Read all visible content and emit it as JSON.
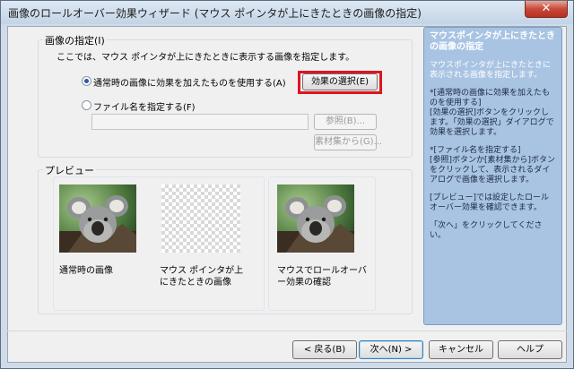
{
  "window": {
    "title": "画像のロールオーバー効果ウィザード (マウス ポインタが上にきたときの画像の指定)",
    "close_glyph": "✕"
  },
  "image_group": {
    "legend": "画像の指定(I)",
    "description": "ここでは、マウス ポインタが上にきたときに表示する画像を指定します。",
    "option_effect": "通常時の画像に効果を加えたものを使用する(A)",
    "effect_button": "効果の選択(E)",
    "option_file": "ファイル名を指定する(F)",
    "file_value": "",
    "browse_button": "参照(B)...",
    "material_button": "素材集から(G)..."
  },
  "preview": {
    "legend": "プレビュー",
    "items": [
      {
        "caption": "通常時の画像",
        "image": "koala-photo"
      },
      {
        "caption": "マウス ポインタが上にきたときの画像",
        "image": "empty-transparent"
      },
      {
        "caption": "マウスでロールオーバー効果の確認",
        "image": "koala-photo"
      }
    ]
  },
  "help": {
    "title": "マウスポインタが上にきたときの画像の指定",
    "subtitle": "マウスポインタが上にきたときに表示される画像を指定します。",
    "para1": "*[通常時の画像に効果を加えたものを使用する]\n[効果の選択]ボタンをクリックします。「効果の選択」ダイアログで効果を選択します。",
    "para2": "*[ファイル名を指定する]\n[参照]ボタンか[素材集から]ボタンをクリックして、表示されるダイアログで画像を選択します。",
    "para3": "[プレビュー]では設定したロールオーバー効果を確認できます。",
    "para4": "「次へ」をクリックしてください。"
  },
  "footer": {
    "back": "< 戻る(B)",
    "next": "次へ(N) >",
    "cancel": "キャンセル",
    "help": "ヘルプ"
  },
  "colors": {
    "highlight": "#e0141f",
    "help_panel": "#a9c4e3",
    "title_bar": "#cfdbe8"
  }
}
